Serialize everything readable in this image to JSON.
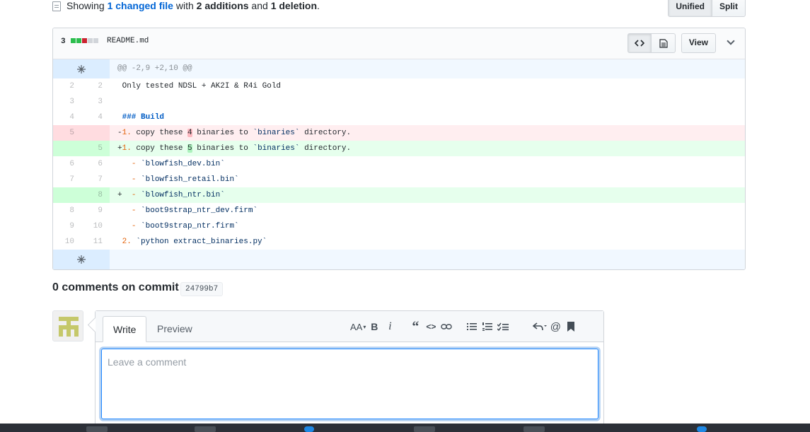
{
  "summary": {
    "prefix": "Showing ",
    "changed": "1 changed file",
    "mid1": " with ",
    "additions": "2 additions",
    "mid2": " and ",
    "deletions": "1 deletion",
    "suffix": "."
  },
  "view_toggle": {
    "unified": "Unified",
    "split": "Split"
  },
  "file": {
    "diffstat_count": "3",
    "diffstat_blocks": [
      "#2cbe4e",
      "#2cbe4e",
      "#cb2431",
      "#d1d5da",
      "#d1d5da"
    ],
    "name": "README.md",
    "view_label": "View",
    "code_icon": "code-icon",
    "rich_icon": "file-icon",
    "expand_icon": "unfold-icon"
  },
  "diff": {
    "hunk_header": "@@ -2,9 +2,10 @@",
    "rows": [
      {
        "old": "2",
        "new": "2",
        "type": "ctx",
        "text": " Only tested NDSL + AK2I & R4i Gold"
      },
      {
        "old": "3",
        "new": "3",
        "type": "ctx",
        "text": " "
      },
      {
        "old": "4",
        "new": "4",
        "type": "ctx",
        "prefix": " ",
        "kw": "### Build"
      },
      {
        "old": "5",
        "new": "",
        "type": "del",
        "sign": "-",
        "num": "1.",
        "pre": " copy these ",
        "hl": "4",
        "post": " binaries to ",
        "str": "`binaries`",
        "end": " directory."
      },
      {
        "old": "",
        "new": "5",
        "type": "add",
        "sign": "+",
        "num": "1.",
        "pre": " copy these ",
        "hl": "5",
        "post": " binaries to ",
        "str": "`binaries`",
        "end": " directory."
      },
      {
        "old": "6",
        "new": "6",
        "type": "ctx",
        "indent": "   ",
        "mk": "-",
        "str": " `blowfish_dev.bin`"
      },
      {
        "old": "7",
        "new": "7",
        "type": "ctx",
        "indent": "   ",
        "mk": "-",
        "str": " `blowfish_retail.bin`"
      },
      {
        "old": "",
        "new": "8",
        "type": "add",
        "indent": "+  ",
        "mk": "-",
        "str": " `blowfish_ntr.bin`"
      },
      {
        "old": "8",
        "new": "9",
        "type": "ctx",
        "indent": "   ",
        "mk": "-",
        "str": " `boot9strap_ntr_dev.firm`"
      },
      {
        "old": "9",
        "new": "10",
        "type": "ctx",
        "indent": "   ",
        "mk": "-",
        "str": " `boot9strap_ntr.firm`"
      },
      {
        "old": "10",
        "new": "11",
        "type": "ctx",
        "indent": " ",
        "mk": "2.",
        "str": " `python extract_binaries.py`"
      }
    ]
  },
  "comments": {
    "title": "0 comments on commit",
    "sha": "24799b7"
  },
  "composer": {
    "tab_write": "Write",
    "tab_preview": "Preview",
    "placeholder": "Leave a comment",
    "toolbar": {
      "heading": "AA",
      "bold": "B",
      "italic": "i",
      "quote": "“",
      "code": "<>",
      "link": "link-icon",
      "ul": "list-icon",
      "ol": "ordered-list-icon",
      "task": "task-list-icon",
      "reply": "reply-icon",
      "mention": "@",
      "bookmark": "bookmark-icon"
    }
  }
}
